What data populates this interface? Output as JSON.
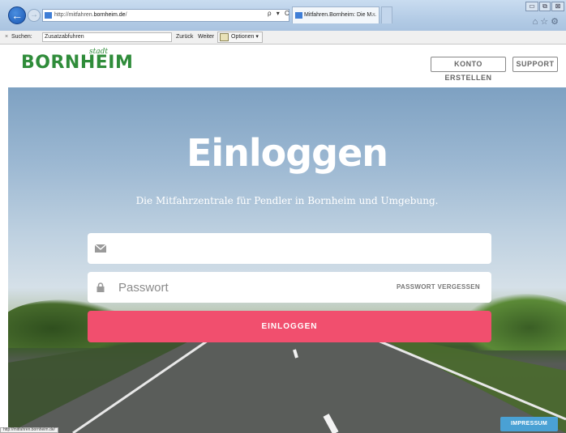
{
  "browser": {
    "address_prefix": "http://mitfahren.",
    "address_domain": "bornheim.de",
    "address_suffix": "/",
    "address_tools": "ρ ▾ C",
    "tab_title": "Mitfahren.Bornheim: Die M...",
    "tab_close": "×",
    "window_minimize": "▭",
    "window_maximize": "⧉",
    "window_close": "⊠",
    "toolbar_icons": "⌂☆⚙",
    "status_url": "http://mitfahren.bornheim.de/"
  },
  "findbar": {
    "close": "×",
    "label": "Suchen:",
    "value": "Zusatzabfuhren",
    "prev": "Zurück",
    "next": "Weiter",
    "options": "Optionen ▾"
  },
  "header": {
    "logo_text": "BORNHEIM",
    "logo_stadt": "stadt",
    "create_account": "KONTO ERSTELLEN",
    "support": "SUPPORT"
  },
  "hero": {
    "title": "Einloggen",
    "subtitle": "Die Mitfahrzentrale für Pendler in Bornheim und Umgebung.",
    "email_placeholder": "",
    "password_placeholder": "Passwort",
    "forgot_password": "PASSWORT VERGESSEN",
    "login_button": "EINLOGGEN"
  },
  "footer": {
    "impressum": "IMPRESSUM"
  },
  "colors": {
    "brand_green": "#2f8c3a",
    "login_pink": "#f14f6e",
    "impressum_blue": "#4aa1d4"
  }
}
